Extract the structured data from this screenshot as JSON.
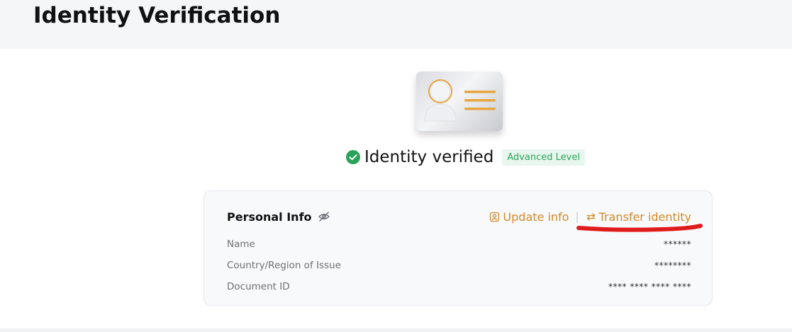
{
  "header": {
    "title": "Identity Verification"
  },
  "status": {
    "text": "Identity verified",
    "level_badge": "Advanced Level",
    "icon": "check-circle-icon",
    "success_color": "#2aa35a"
  },
  "personal_info": {
    "title": "Personal Info",
    "visibility_icon": "eye-off-icon",
    "actions": {
      "update_label": "Update info",
      "transfer_label": "Transfer identity",
      "separator": "|",
      "accent_color": "#d18a2a"
    },
    "fields": [
      {
        "label": "Name",
        "value": "******"
      },
      {
        "label": "Country/Region of Issue",
        "value": "********"
      },
      {
        "label": "Document ID",
        "value": "**** **** **** ****"
      }
    ]
  },
  "annotation": {
    "color": "#e01b1b",
    "target": "transfer-identity-link"
  }
}
